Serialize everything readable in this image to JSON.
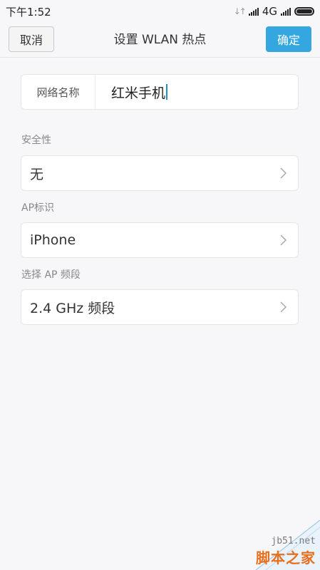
{
  "status_bar": {
    "time": "下午1:52",
    "network": "4G"
  },
  "header": {
    "cancel_label": "取消",
    "title": "设置 WLAN 热点",
    "ok_label": "确定"
  },
  "network_name": {
    "label": "网络名称",
    "value": "红米手机"
  },
  "security": {
    "label": "安全性",
    "value": "无"
  },
  "ap_id": {
    "label": "AP标识",
    "value": "iPhone"
  },
  "band": {
    "label": "选择 AP 频段",
    "value": "2.4 GHz 频段"
  },
  "watermark": {
    "site": "jb51.net",
    "name": "脚本之家"
  },
  "colors": {
    "accent": "#35a7e0",
    "background": "#f7f7f9",
    "watermark": "#e86f1c"
  }
}
